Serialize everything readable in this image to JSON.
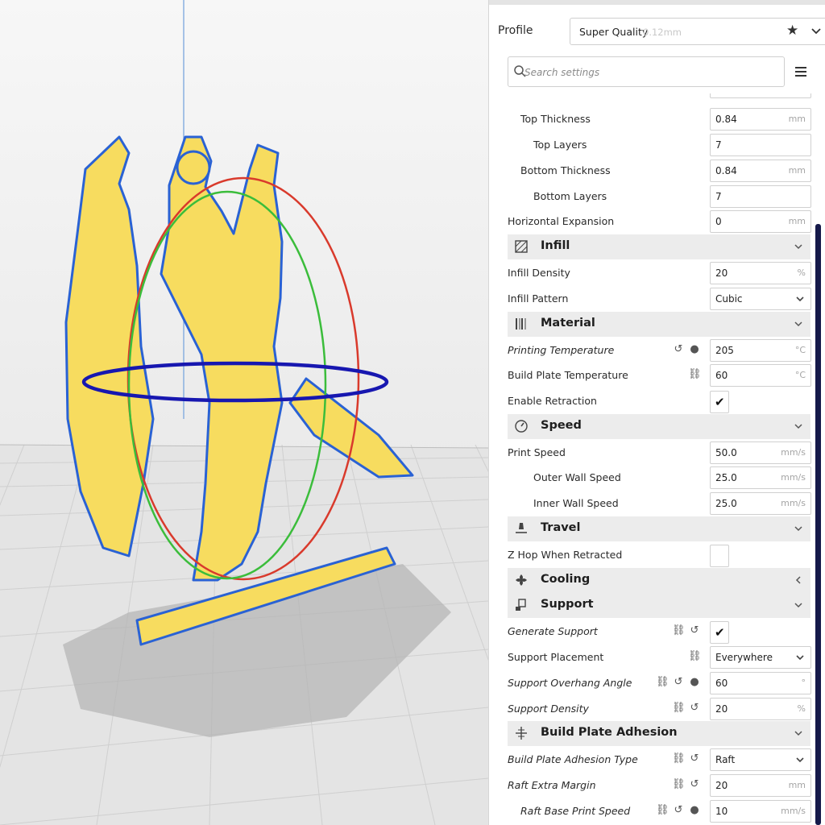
{
  "colors": {
    "accent": "#15194a",
    "model": "#f7dc5f",
    "model_outline": "#2a62d4",
    "ring_x": "#d93a2c",
    "ring_y": "#3bbd3b",
    "ring_z": "#1717b0"
  },
  "profile": {
    "label": "Profile",
    "name": "Super Quality",
    "layer_height": "0.12mm",
    "favorite_icon": "star-icon",
    "dropdown_icon": "chevron-down-icon"
  },
  "search": {
    "placeholder": "Search settings",
    "value": "",
    "icon": "search-icon",
    "menu_icon": "menu-icon"
  },
  "settings": [
    {
      "kind": "setting",
      "label": "Top Thickness",
      "value": "0.84",
      "unit": "mm"
    },
    {
      "kind": "setting",
      "label": "Top Layers",
      "value": "7",
      "unit": ""
    },
    {
      "kind": "setting",
      "label": "Bottom Thickness",
      "value": "0.84",
      "unit": "mm"
    },
    {
      "kind": "setting",
      "label": "Bottom Layers",
      "value": "7",
      "unit": ""
    },
    {
      "kind": "setting",
      "label": "Horizontal Expansion",
      "value": "0",
      "unit": "mm"
    },
    {
      "kind": "category",
      "label": "Infill",
      "icon": "infill-icon",
      "state": "expanded"
    },
    {
      "kind": "setting",
      "label": "Infill Density",
      "value": "20",
      "unit": "%"
    },
    {
      "kind": "select",
      "label": "Infill Pattern",
      "value": "Cubic"
    },
    {
      "kind": "category",
      "label": "Material",
      "icon": "material-icon",
      "state": "expanded"
    },
    {
      "kind": "setting",
      "label": "Printing Temperature",
      "value": "205",
      "unit": "°C",
      "italic": true,
      "icons": [
        "reset-icon",
        "info-icon"
      ]
    },
    {
      "kind": "setting",
      "label": "Build Plate Temperature",
      "value": "60",
      "unit": "°C",
      "icons": [
        "link-icon"
      ]
    },
    {
      "kind": "checkbox",
      "label": "Enable Retraction",
      "checked": true
    },
    {
      "kind": "category",
      "label": "Speed",
      "icon": "speed-icon",
      "state": "expanded"
    },
    {
      "kind": "setting",
      "label": "Print Speed",
      "value": "50.0",
      "unit": "mm/s"
    },
    {
      "kind": "setting",
      "label": "Outer Wall Speed",
      "value": "25.0",
      "unit": "mm/s"
    },
    {
      "kind": "setting",
      "label": "Inner Wall Speed",
      "value": "25.0",
      "unit": "mm/s"
    },
    {
      "kind": "category",
      "label": "Travel",
      "icon": "travel-icon",
      "state": "expanded"
    },
    {
      "kind": "checkbox",
      "label": "Z Hop When Retracted",
      "checked": false
    },
    {
      "kind": "category",
      "label": "Cooling",
      "icon": "cooling-icon",
      "state": "collapsed"
    },
    {
      "kind": "category",
      "label": "Support",
      "icon": "support-icon",
      "state": "expanded"
    },
    {
      "kind": "checkbox",
      "label": "Generate Support",
      "checked": true,
      "italic": true,
      "icons": [
        "link-icon",
        "reset-icon"
      ]
    },
    {
      "kind": "select",
      "label": "Support Placement",
      "value": "Everywhere",
      "icons": [
        "link-icon"
      ]
    },
    {
      "kind": "setting",
      "label": "Support Overhang Angle",
      "value": "60",
      "unit": "°",
      "italic": true,
      "icons": [
        "link-icon",
        "reset-icon",
        "info-icon"
      ]
    },
    {
      "kind": "setting",
      "label": "Support Density",
      "value": "20",
      "unit": "%",
      "italic": true,
      "icons": [
        "link-icon",
        "reset-icon"
      ]
    },
    {
      "kind": "category",
      "label": "Build Plate Adhesion",
      "icon": "adhesion-icon",
      "state": "expanded"
    },
    {
      "kind": "select",
      "label": "Build Plate Adhesion Type",
      "value": "Raft",
      "italic": true,
      "icons": [
        "link-icon",
        "reset-icon"
      ]
    },
    {
      "kind": "setting",
      "label": "Raft Extra Margin",
      "value": "20",
      "unit": "mm",
      "italic": true,
      "icons": [
        "link-icon",
        "reset-icon"
      ]
    },
    {
      "kind": "setting",
      "label": "Raft Base Print Speed",
      "value": "10",
      "unit": "mm/s",
      "italic": true,
      "icons": [
        "link-icon",
        "reset-icon",
        "info-icon"
      ]
    }
  ]
}
